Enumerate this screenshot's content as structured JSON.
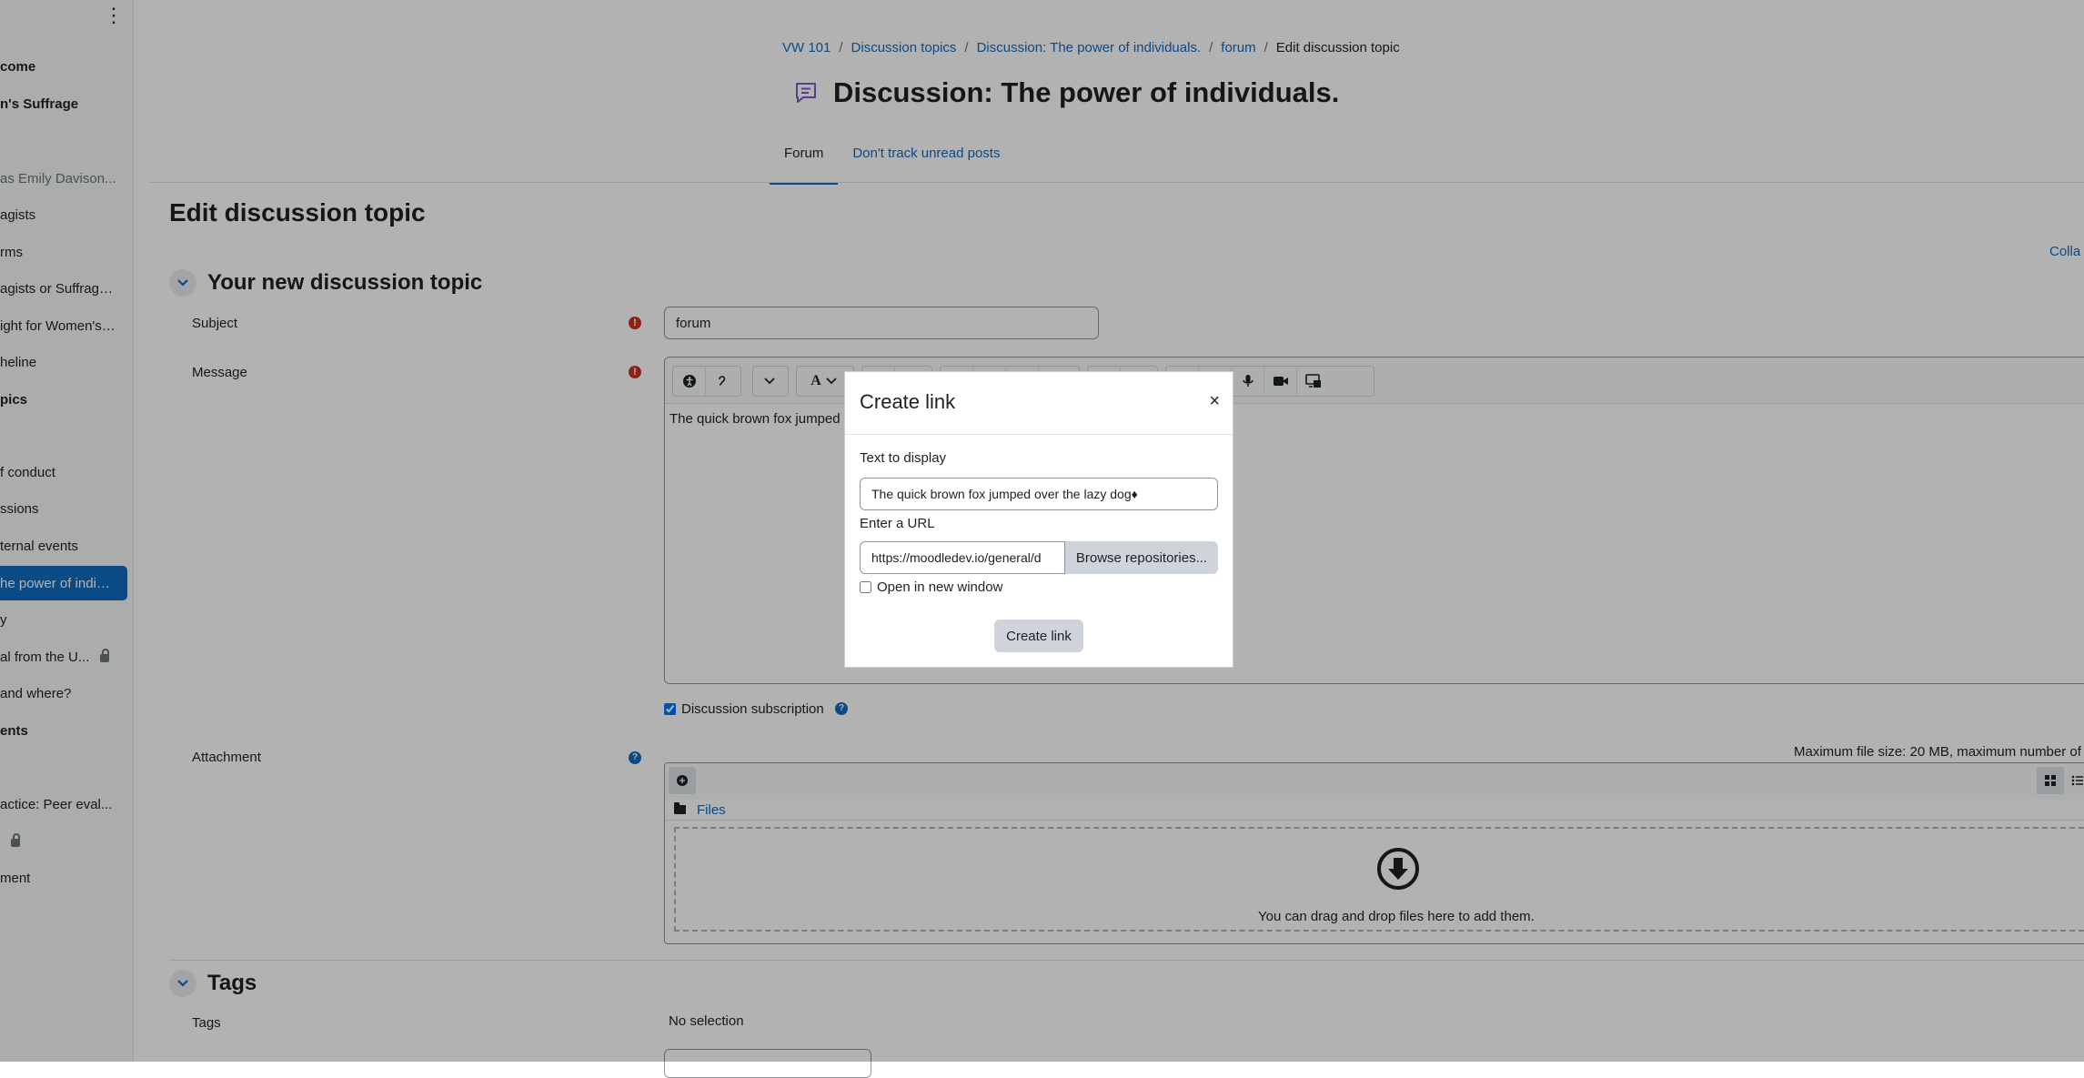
{
  "sidebar": {
    "menu_icon": "kebab-icon",
    "items": [
      {
        "label": "come",
        "style": "bold"
      },
      {
        "label": "n's Suffrage",
        "style": "bold"
      },
      {
        "label": "as Emily Davison...",
        "style": "muted"
      },
      {
        "label": "agists",
        "style": "normal"
      },
      {
        "label": "rms",
        "style": "normal"
      },
      {
        "label": "agists or Suffrage...",
        "style": "normal"
      },
      {
        "label": "ight for Women's ...",
        "style": "normal"
      },
      {
        "label": "heline",
        "style": "normal"
      },
      {
        "label": "pics",
        "style": "bold"
      },
      {
        "label": "f conduct",
        "style": "normal"
      },
      {
        "label": "ssions",
        "style": "normal"
      },
      {
        "label": "ternal events",
        "style": "normal"
      },
      {
        "label": "he power of indivi...",
        "style": "active"
      },
      {
        "label": "y",
        "style": "normal"
      },
      {
        "label": "al from the U...",
        "style": "normal",
        "locked": true
      },
      {
        "label": " and where?",
        "style": "normal"
      },
      {
        "label": "ents",
        "style": "bold"
      },
      {
        "label": "actice: Peer eval...",
        "style": "normal"
      },
      {
        "label": "",
        "style": "normal",
        "locked": true
      },
      {
        "label": "ment",
        "style": "normal"
      }
    ]
  },
  "breadcrumb": [
    "VW 101",
    "Discussion topics",
    "Discussion: The power of individuals.",
    "forum",
    "Edit discussion topic"
  ],
  "page_title": "Discussion: The power of individuals.",
  "tabs": [
    {
      "label": "Forum",
      "active": true
    },
    {
      "label": "Don't track unread posts",
      "active": false
    }
  ],
  "form": {
    "heading": "Edit discussion topic",
    "collapse_all": "Colla",
    "section_title": "Your new discussion topic",
    "subject_label": "Subject",
    "subject_value": "forum",
    "message_label": "Message",
    "message_text": "The quick brown fox jumped",
    "subscription_label": "Discussion subscription",
    "subscription_checked": true,
    "attachment_label": "Attachment",
    "max_size": "Maximum file size: 20 MB, maximum number of",
    "files_link": "Files",
    "drop_text": "You can drag and drop files here to add them.",
    "tags_section": "Tags",
    "tags_label": "Tags",
    "tags_value": "No selection"
  },
  "modal": {
    "title": "Create link",
    "close": "×",
    "text_label": "Text to display",
    "text_value": "The quick brown fox jumped over the lazy dog♦",
    "url_label": "Enter a URL",
    "url_value": "https://moodledev.io/general/d",
    "browse_label": "Browse repositories...",
    "new_window_label": "Open in new window",
    "new_window_checked": false,
    "submit_label": "Create link"
  },
  "colors": {
    "accent": "#0f6cbf",
    "required": "#ca3120",
    "backdrop": "rgba(0,0,0,0.3)"
  }
}
